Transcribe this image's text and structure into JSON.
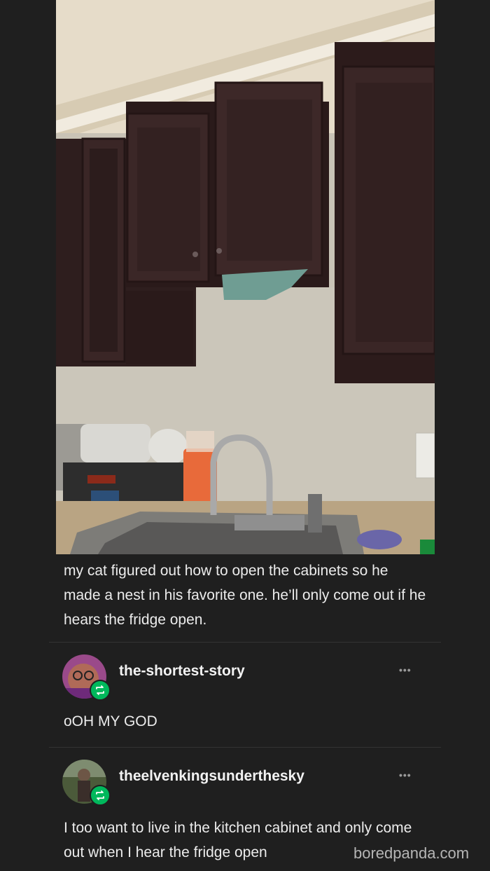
{
  "post": {
    "caption": "my cat figured out how to open the cabinets so he made a nest in his favorite one. he’ll only come out if he hears the fridge open."
  },
  "reblogs": [
    {
      "username": "the-shortest-story",
      "text": "oOH MY GOD",
      "more_label": "•••"
    },
    {
      "username": "theelvenkingsunderthesky",
      "text": "I too want to live in the kitchen cabinet and only come out when I hear the fridge open",
      "more_label": "•••"
    }
  ],
  "watermark": "boredpanda.com",
  "colors": {
    "background": "#1f1f1f",
    "reblog_badge": "#00b85c",
    "text": "#ececec"
  }
}
